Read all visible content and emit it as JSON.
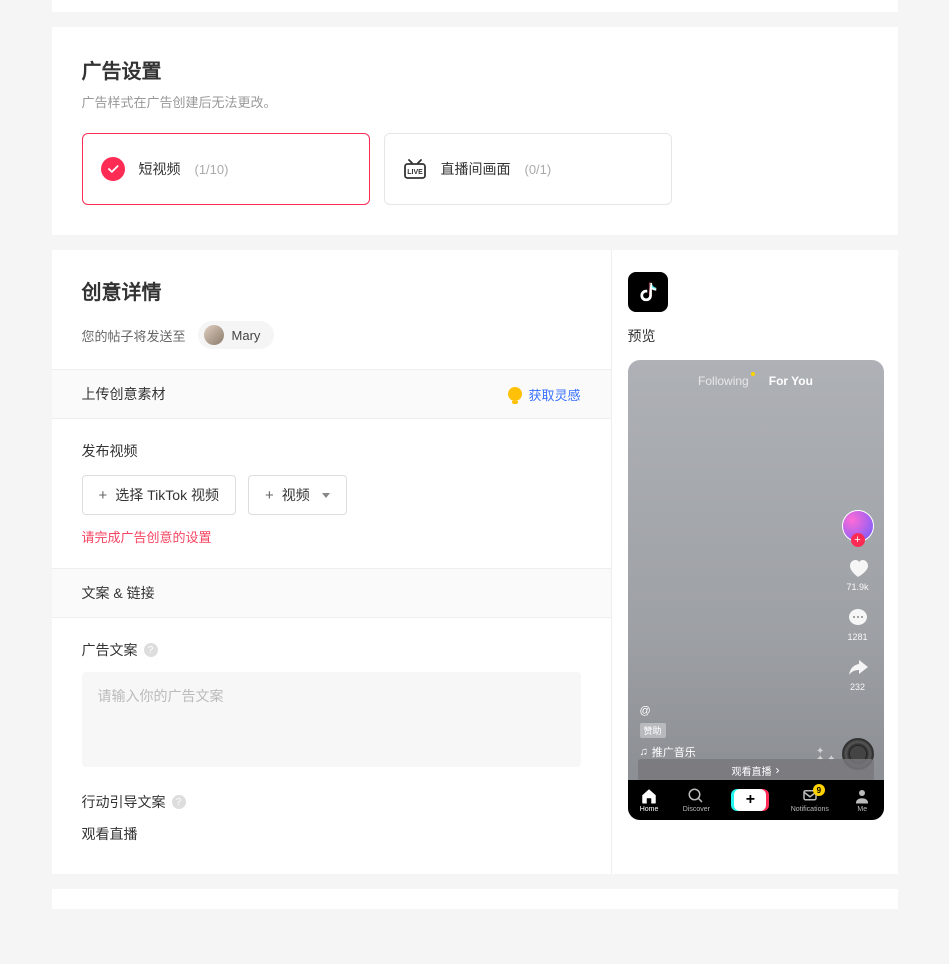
{
  "settings": {
    "title": "广告设置",
    "subtitle": "广告样式在广告创建后无法更改。",
    "options": [
      {
        "label": "短视频",
        "count": "(1/10)"
      },
      {
        "label": "直播间画面",
        "count": "(0/1)"
      }
    ]
  },
  "creative": {
    "title": "创意详情",
    "post_to_label": "您的帖子将发送至",
    "user_name": "Mary",
    "upload": {
      "header": "上传创意素材",
      "inspire": "获取灵感",
      "field_label": "发布视频",
      "btn_tiktok": "选择 TikTok 视频",
      "btn_video": "视频",
      "error": "请完成广告创意的设置"
    },
    "copy": {
      "header": "文案 & 链接",
      "label": "广告文案",
      "placeholder": "请输入你的广告文案"
    },
    "cta": {
      "label": "行动引导文案",
      "value": "观看直播"
    }
  },
  "preview": {
    "label": "预览",
    "tabs": {
      "following": "Following",
      "foryou": "For You"
    },
    "counts": {
      "likes": "71.9k",
      "comments": "1281",
      "shares": "232"
    },
    "at": "@",
    "sponsor_chip": "赞助",
    "music": "推广音乐",
    "cta_button": "观看直播",
    "nav": {
      "home": "Home",
      "discover": "Discover",
      "notifications": "Notifications",
      "me": "Me",
      "badge": "9"
    }
  }
}
